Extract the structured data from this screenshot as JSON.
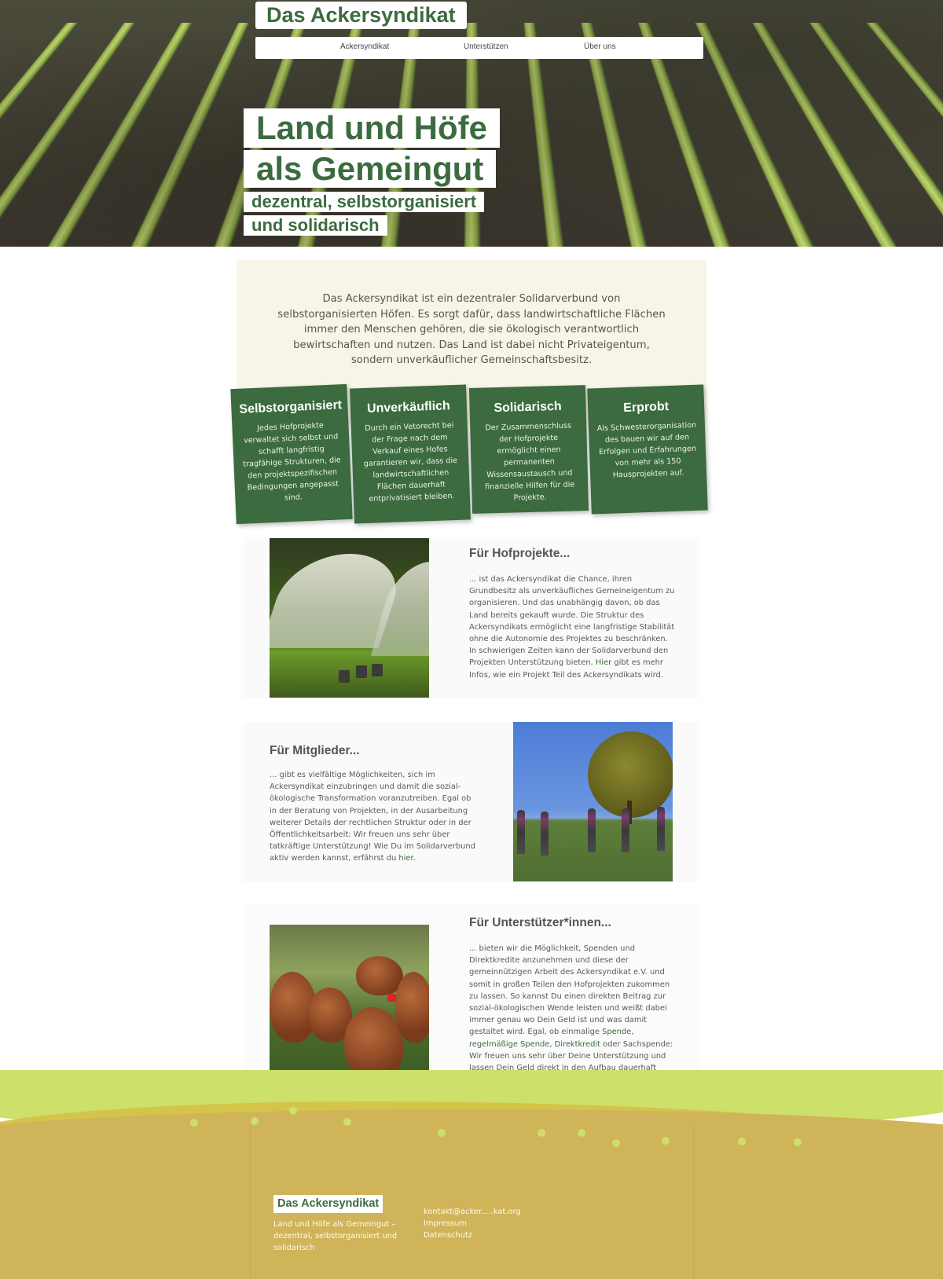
{
  "header": {
    "site_title": "Das Ackersyndikat",
    "nav": [
      {
        "label": "Ackersyndikat"
      },
      {
        "label": "Unterstützen"
      },
      {
        "label": "Über uns"
      }
    ]
  },
  "hero": {
    "line1": "Land und Höfe",
    "line2": "als Gemeingut",
    "line3": "dezentral, selbstorganisiert",
    "line4": "und solidarisch"
  },
  "intro": {
    "text": "Das Ackersyndikat ist ein dezentraler Solidarverbund von selbstorganisierten Höfen. Es sorgt dafür, dass landwirtschaftliche Flächen immer den Menschen gehören, die sie ökologisch verantwortlich bewirtschaften und nutzen. Das Land ist dabei nicht Privateigentum, sondern unverkäuflicher Gemeinschaftsbesitz."
  },
  "pillars": [
    {
      "title": "Selbstorganisiert",
      "text": "Jedes Hofprojekte verwaltet sich selbst und schafft langfristig tragfähige Strukturen, die den projektspezifischen Bedingungen angepasst sind."
    },
    {
      "title": "Unverkäuflich",
      "text": "Durch ein Vetorecht bei der Frage nach dem Verkauf eines Hofes garantieren wir, dass die landwirtschaftlichen Flächen dauerhaft entprivatisiert bleiben."
    },
    {
      "title": "Solidarisch",
      "text": "Der Zusammenschluss der Hofprojekte ermöglicht einen permanenten Wissensaustausch und finanzielle Hilfen für die Projekte."
    },
    {
      "title": "Erprobt",
      "text": "Als Schwesterorganisation des bauen wir auf den Erfolgen und Erfahrungen von mehr als 150 Hausprojekten auf."
    }
  ],
  "sections": {
    "hof": {
      "title": "Für Hofprojekte...",
      "text": "... ist das Ackersyndikat die Chance, ihren Grundbesitz als unverkäufliches Gemeineigentum zu organisieren. Und das unabhängig davon, ob das Land bereits gekauft wurde. Die Struktur des Ackersyndikats ermöglicht eine langfristige Stabilität ohne die Autonomie des Projektes zu beschränken. In schwierigen Zeiten kann der Solidarverbund den Projekten Unterstützung bieten.",
      "link": "Hier",
      "text_after": " gibt es mehr Infos, wie ein Projekt Teil des Ackersyndikats wird."
    },
    "mitglieder": {
      "title": "Für Mitglieder...",
      "text": "... gibt es vielfältige Möglichkeiten, sich im Ackersyndikat einzubringen und damit die sozial-ökologische Transformation voranzutreiben. Egal ob in der Beratung von Projekten, in der Ausarbeitung weiterer Details der rechtlichen Struktur oder in der Öffentlichkeitsarbeit: Wir freuen uns sehr über tatkräftige Unterstützung! Wie Du im Solidarverbund aktiv werden kannst, erfährst du ",
      "link": "hier",
      "text_after": "."
    },
    "unterstuetzer": {
      "title": "Für Unterstützer*innen...",
      "text": "... bieten wir die Möglichkeit, Spenden und Direktkredite anzunehmen und diese der gemeinnützigen Arbeit des Ackersyndikat e.V. und somit in großen Teilen den Hofprojekten zukommen zu lassen. So kannst Du einen direkten Beitrag zur sozial-ökologischen Wende leisten und weißt dabei immer genau wo Dein Geld ist und was damit gestaltet wird. Egal, ob einmalige ",
      "link1": "Spende",
      "sep1": ", ",
      "link2": "regelmäßige Spende",
      "sep2": ", ",
      "link3": "Direktkredit",
      "text_after": " oder Sachspende: Wir freuen uns sehr über Deine Unterstützung und lassen Dein Geld direkt in den Aufbau dauerhaft unverkäuflicher sozial-ökologischer Hofprojekte fließen."
    }
  },
  "footer": {
    "logo": "Das Ackersyndikat",
    "tagline": "Land und Höfe als Gemeingut – dezentral, selbstorganisiert und solidarisch",
    "links": [
      {
        "label": "kontakt@acker.....kat.org"
      },
      {
        "label": "Impressum"
      },
      {
        "label": "Datenschutz"
      }
    ]
  }
}
